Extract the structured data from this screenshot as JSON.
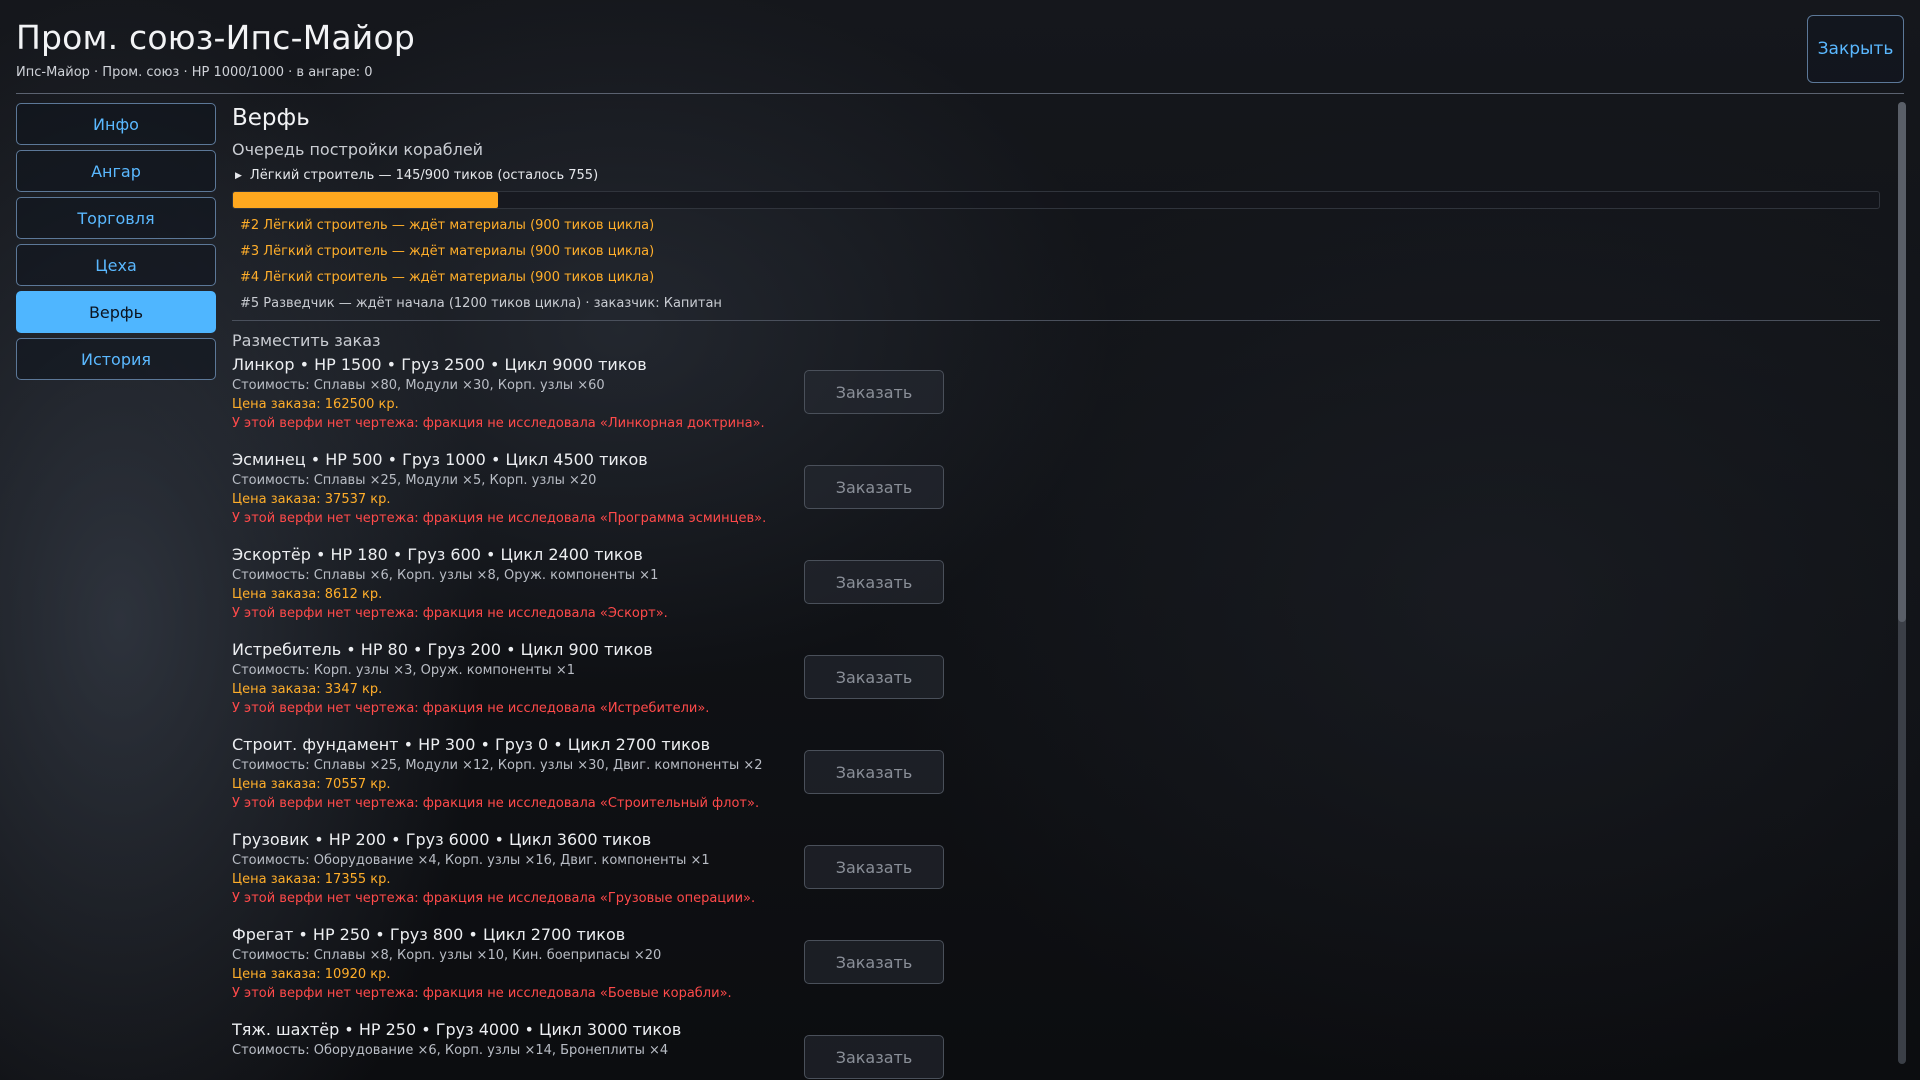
{
  "header": {
    "title": "Пром. союз-Ипс-Майор",
    "subtitle": "Ипс-Майор · Пром. союз · HP 1000/1000 · в ангаре: 0",
    "close_label": "Закрыть"
  },
  "sidebar": {
    "items": [
      {
        "label": "Инфо"
      },
      {
        "label": "Ангар"
      },
      {
        "label": "Торговля"
      },
      {
        "label": "Цеха"
      },
      {
        "label": "Верфь",
        "active": true
      },
      {
        "label": "История"
      }
    ]
  },
  "shipyard": {
    "title": "Верфь",
    "queue_heading": "Очередь постройки кораблей",
    "current": {
      "label": "Лёгкий строитель — 145/900 тиков (осталось 755)",
      "progress": 0.161
    },
    "queue": [
      {
        "text": "#2 Лёгкий строитель — ждёт материалы (900 тиков цикла)",
        "state": "waiting"
      },
      {
        "text": "#3 Лёгкий строитель — ждёт материалы (900 тиков цикла)",
        "state": "waiting"
      },
      {
        "text": "#4 Лёгкий строитель — ждёт материалы (900 тиков цикла)",
        "state": "waiting"
      },
      {
        "text": "#5 Разведчик — ждёт начала (1200 тиков цикла) · заказчик: Капитан",
        "state": "pending"
      }
    ],
    "order_heading": "Разместить заказ",
    "order_button_label": "Заказать",
    "ships": [
      {
        "name": "Линкор  •  HP 1500  •  Груз 2500  •  Цикл 9000 тиков",
        "cost": "Стоимость: Сплавы ×80, Модули ×30, Корп. узлы ×60",
        "price": "Цена заказа: 162500 кр.",
        "warning": "У этой верфи нет чертежа: фракция не исследовала «Линкорная доктрина»."
      },
      {
        "name": "Эсминец  •  HP 500  •  Груз 1000  •  Цикл 4500 тиков",
        "cost": "Стоимость: Сплавы ×25, Модули ×5, Корп. узлы ×20",
        "price": "Цена заказа: 37537 кр.",
        "warning": "У этой верфи нет чертежа: фракция не исследовала «Программа эсминцев»."
      },
      {
        "name": "Эскортёр  •  HP 180  •  Груз 600  •  Цикл 2400 тиков",
        "cost": "Стоимость: Сплавы ×6, Корп. узлы ×8, Оруж. компоненты ×1",
        "price": "Цена заказа: 8612 кр.",
        "warning": "У этой верфи нет чертежа: фракция не исследовала «Эскорт»."
      },
      {
        "name": "Истребитель  •  HP 80  •  Груз 200  •  Цикл 900 тиков",
        "cost": "Стоимость: Корп. узлы ×3, Оруж. компоненты ×1",
        "price": "Цена заказа: 3347 кр.",
        "warning": "У этой верфи нет чертежа: фракция не исследовала «Истребители»."
      },
      {
        "name": "Строит. фундамент  •  HP 300  •  Груз 0  •  Цикл 2700 тиков",
        "cost": "Стоимость: Сплавы ×25, Модули ×12, Корп. узлы ×30, Двиг. компоненты ×2",
        "price": "Цена заказа: 70557 кр.",
        "warning": "У этой верфи нет чертежа: фракция не исследовала «Строительный флот»."
      },
      {
        "name": "Грузовик  •  HP 200  •  Груз 6000  •  Цикл 3600 тиков",
        "cost": "Стоимость: Оборудование ×4, Корп. узлы ×16, Двиг. компоненты ×1",
        "price": "Цена заказа: 17355 кр.",
        "warning": "У этой верфи нет чертежа: фракция не исследовала «Грузовые операции»."
      },
      {
        "name": "Фрегат  •  HP 250  •  Груз 800  •  Цикл 2700 тиков",
        "cost": "Стоимость: Сплавы ×8, Корп. узлы ×10, Кин. боеприпасы ×20",
        "price": "Цена заказа: 10920 кр.",
        "warning": "У этой верфи нет чертежа: фракция не исследовала «Боевые корабли»."
      },
      {
        "name": "Тяж. шахтёр  •  HP 250  •  Груз 4000  •  Цикл 3000 тиков",
        "cost": "Стоимость: Оборудование ×6, Корп. узлы ×14, Бронеплиты ×4",
        "price": "",
        "warning": ""
      }
    ]
  },
  "colors": {
    "accent": "#4fb6ff",
    "progress": "#ffa81f",
    "price": "#ffae2a",
    "warning": "#ff4a4a"
  }
}
